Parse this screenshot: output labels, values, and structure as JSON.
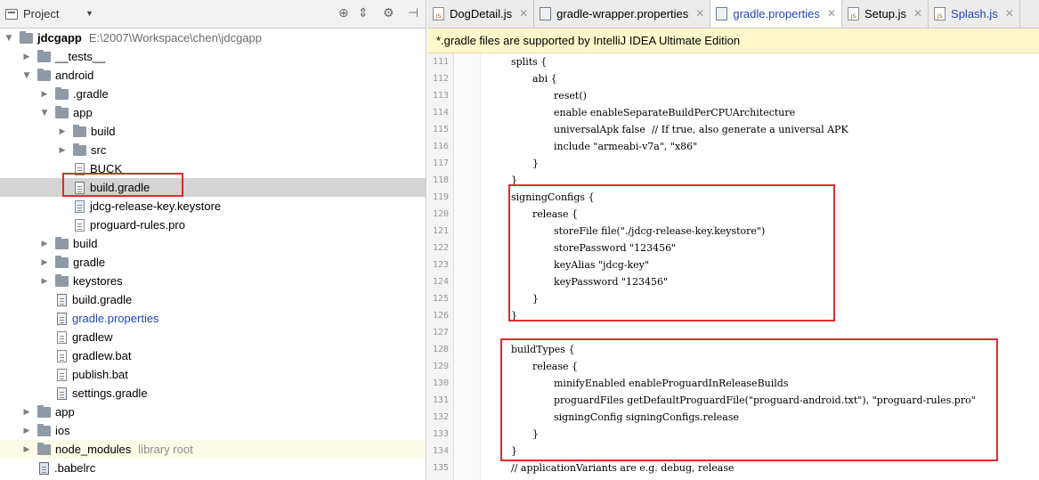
{
  "project_panel": {
    "title": "Project",
    "tools": [
      "target-icon",
      "collapse-icon",
      "gear-icon",
      "pin-icon"
    ],
    "tree": [
      {
        "label": "jdcgapp",
        "path": "E:\\2007\\Workspace\\chen\\jdcgapp",
        "type": "folder",
        "expanded": true,
        "level": 0,
        "bold": true
      },
      {
        "label": "__tests__",
        "type": "folder",
        "expanded": false,
        "level": 1
      },
      {
        "label": "android",
        "type": "folder",
        "expanded": true,
        "level": 1
      },
      {
        "label": ".gradle",
        "type": "folder",
        "expanded": false,
        "level": 2
      },
      {
        "label": "app",
        "type": "folder",
        "expanded": true,
        "level": 2
      },
      {
        "label": "build",
        "type": "folder",
        "expanded": false,
        "level": 3
      },
      {
        "label": "src",
        "type": "folder",
        "expanded": false,
        "level": 3
      },
      {
        "label": "BUCK",
        "type": "file",
        "level": 3
      },
      {
        "label": "build.gradle",
        "type": "gradle",
        "level": 3,
        "selected": true
      },
      {
        "label": "jdcg-release-key.keystore",
        "type": "key",
        "level": 3
      },
      {
        "label": "proguard-rules.pro",
        "type": "file",
        "level": 3
      },
      {
        "label": "build",
        "type": "folder",
        "expanded": false,
        "level": 2
      },
      {
        "label": "gradle",
        "type": "folder",
        "expanded": false,
        "level": 2
      },
      {
        "label": "keystores",
        "type": "folder",
        "expanded": false,
        "level": 2
      },
      {
        "label": "build.gradle",
        "type": "gradle",
        "level": 2
      },
      {
        "label": "gradle.properties",
        "type": "gradle",
        "level": 2,
        "blue": true
      },
      {
        "label": "gradlew",
        "type": "file",
        "level": 2
      },
      {
        "label": "gradlew.bat",
        "type": "file",
        "level": 2
      },
      {
        "label": "publish.bat",
        "type": "file",
        "level": 2
      },
      {
        "label": "settings.gradle",
        "type": "gradle",
        "level": 2
      },
      {
        "label": "app",
        "type": "folder",
        "expanded": false,
        "level": 1
      },
      {
        "label": "ios",
        "type": "folder",
        "expanded": false,
        "level": 1
      },
      {
        "label": "node_modules",
        "type": "folder",
        "expanded": false,
        "level": 1,
        "extra": "library root",
        "lib": true
      },
      {
        "label": ".babelrc",
        "type": "json",
        "level": 1
      }
    ]
  },
  "editor": {
    "tabs": [
      {
        "label": "DogDetail.js",
        "icon": "js",
        "active": false
      },
      {
        "label": "gradle-wrapper.properties",
        "icon": "gradle",
        "active": false
      },
      {
        "label": "gradle.properties",
        "icon": "gradle",
        "active": true,
        "blue": true
      },
      {
        "label": "Setup.js",
        "icon": "js",
        "active": false
      },
      {
        "label": "Splash.js",
        "icon": "js",
        "active": false,
        "blue": true
      }
    ],
    "notice": "*.gradle files are supported by IntelliJ IDEA Ultimate Edition",
    "lines": [
      {
        "num": "111",
        "text": "splits {",
        "indent": 1
      },
      {
        "num": "112",
        "text": "abi {",
        "indent": 2
      },
      {
        "num": "113",
        "text": "reset()",
        "indent": 3
      },
      {
        "num": "114",
        "text": "enable enableSeparateBuildPerCPUArchitecture",
        "indent": 3
      },
      {
        "num": "115",
        "text": "universalApk false  // If true, also generate a universal APK",
        "indent": 3
      },
      {
        "num": "116",
        "text": "include \"armeabi-v7a\", \"x86\"",
        "indent": 3
      },
      {
        "num": "117",
        "text": "}",
        "indent": 2
      },
      {
        "num": "118",
        "text": "}",
        "indent": 1
      },
      {
        "num": "119",
        "text": "signingConfigs {",
        "indent": 1
      },
      {
        "num": "120",
        "text": "release {",
        "indent": 2
      },
      {
        "num": "121",
        "text": "storeFile file(\"./jdcg-release-key.keystore\")",
        "indent": 3
      },
      {
        "num": "122",
        "text": "storePassword \"123456\"",
        "indent": 3
      },
      {
        "num": "123",
        "text": "keyAlias \"jdcg-key\"",
        "indent": 3
      },
      {
        "num": "124",
        "text": "keyPassword \"123456\"",
        "indent": 3
      },
      {
        "num": "125",
        "text": "}",
        "indent": 2
      },
      {
        "num": "126",
        "text": "}",
        "indent": 1
      },
      {
        "num": "127",
        "text": "",
        "indent": 1
      },
      {
        "num": "128",
        "text": "buildTypes {",
        "indent": 1
      },
      {
        "num": "129",
        "text": "release {",
        "indent": 2
      },
      {
        "num": "130",
        "text": "minifyEnabled enableProguardInReleaseBuilds",
        "indent": 3
      },
      {
        "num": "131",
        "text": "proguardFiles getDefaultProguardFile(\"proguard-android.txt\"), \"proguard-rules.pro\"",
        "indent": 3
      },
      {
        "num": "132",
        "text": "signingConfig signingConfigs.release",
        "indent": 3
      },
      {
        "num": "133",
        "text": "}",
        "indent": 2
      },
      {
        "num": "134",
        "text": "}",
        "indent": 1
      },
      {
        "num": "135",
        "text": "// applicationVariants are e.g. debug, release",
        "indent": 1
      }
    ]
  },
  "colors": {
    "highlight": "#e02b2b",
    "blue_text": "#2546b6",
    "notice_bg": "#fff7cc"
  }
}
